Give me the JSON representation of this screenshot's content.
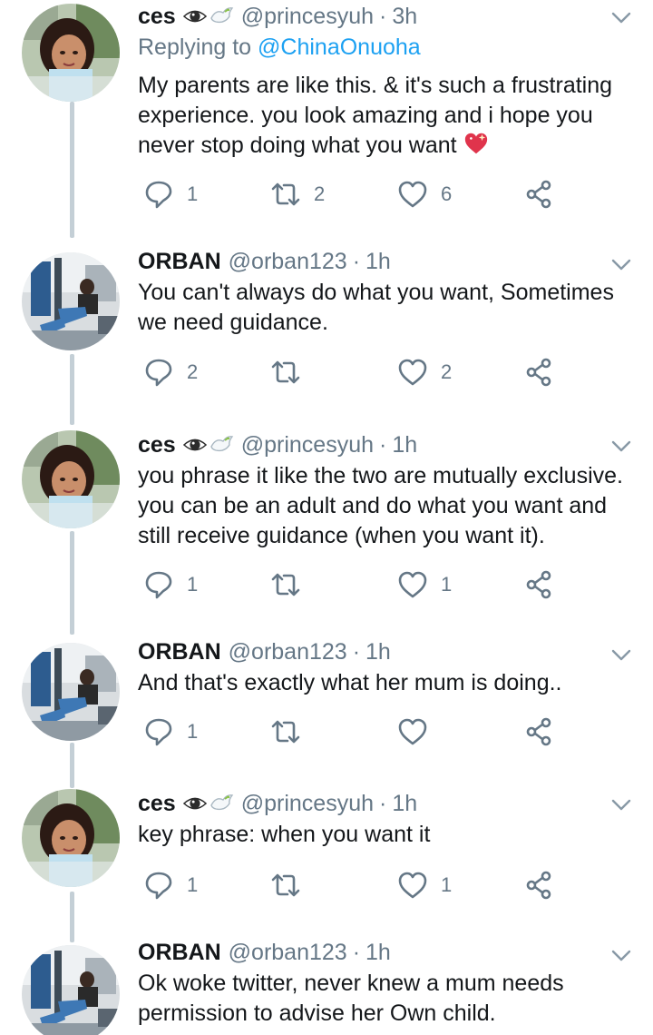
{
  "tweets": [
    {
      "name": "ces",
      "handle": "@princesyuh",
      "dot": "·",
      "time": "3h",
      "reply_prefix": "Replying to ",
      "reply_to": "@ChinaOnuoha",
      "text_lines": [
        "My parents are like this. & it's such a frustrating",
        "experience. you look amazing and i hope you",
        "never stop doing what you want"
      ],
      "trailing_emoji": "sparkling-heart",
      "replies": "1",
      "retweets": "2",
      "likes": "6",
      "avatar": "woman-avatar"
    },
    {
      "name": "ORBAN",
      "handle": "@orban123",
      "dot": "·",
      "time": "1h",
      "text_lines": [
        "You can't always do what you want, Sometimes",
        "we need guidance."
      ],
      "replies": "2",
      "retweets": "",
      "likes": "2",
      "avatar": "man-avatar"
    },
    {
      "name": "ces",
      "handle": "@princesyuh",
      "dot": "·",
      "time": "1h",
      "text_lines": [
        "you phrase it like the two are mutually exclusive.",
        "you can be an adult and do what you want and",
        "still receive guidance (when you want it)."
      ],
      "replies": "1",
      "retweets": "",
      "likes": "1",
      "avatar": "woman-avatar"
    },
    {
      "name": "ORBAN",
      "handle": "@orban123",
      "dot": "·",
      "time": "1h",
      "text_lines": [
        "And that's exactly what her mum is doing.."
      ],
      "replies": "1",
      "retweets": "",
      "likes": "",
      "avatar": "man-avatar"
    },
    {
      "name": "ces",
      "handle": "@princesyuh",
      "dot": "·",
      "time": "1h",
      "text_lines": [
        "key phrase: when you want it"
      ],
      "replies": "1",
      "retweets": "",
      "likes": "1",
      "avatar": "woman-avatar"
    },
    {
      "name": "ORBAN",
      "handle": "@orban123",
      "dot": "·",
      "time": "1h",
      "text_lines": [
        "Ok woke twitter, never knew a mum needs",
        "permission to advise her Own child."
      ],
      "avatar": "man-avatar"
    }
  ],
  "name_emojis": [
    "eye",
    "dove"
  ],
  "colors": {
    "text": "#14171a",
    "secondary": "#657786",
    "link": "#1da1f2",
    "thread_line": "#c4cfd6"
  }
}
